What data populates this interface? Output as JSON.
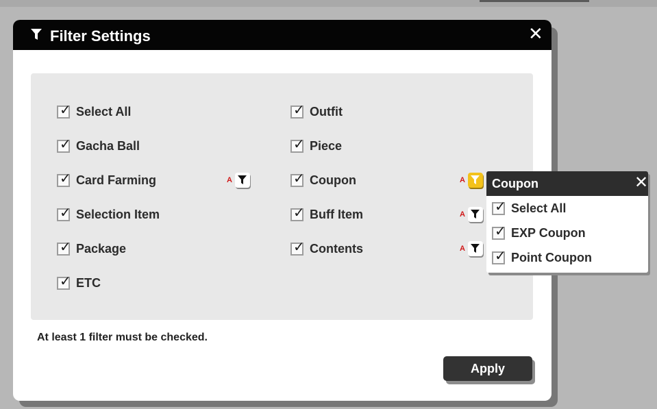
{
  "dialog": {
    "title": "Filter Settings",
    "close_symbol": "✕",
    "title_icon": "filter-icon"
  },
  "filters": {
    "left": [
      {
        "label": "Select All",
        "checked": true
      },
      {
        "label": "Gacha Ball",
        "checked": true
      },
      {
        "label": "Card Farming",
        "checked": true
      },
      {
        "label": "Selection Item",
        "checked": true
      },
      {
        "label": "Package",
        "checked": true
      },
      {
        "label": "ETC",
        "checked": true
      }
    ],
    "right": [
      {
        "label": "Outfit",
        "checked": true
      },
      {
        "label": "Piece",
        "checked": true
      },
      {
        "label": "Coupon",
        "checked": true
      },
      {
        "label": "Buff Item",
        "checked": true
      },
      {
        "label": "Contents",
        "checked": true
      }
    ],
    "sub_filter_marker": "A",
    "check_symbol": "✓"
  },
  "note": "At least 1 filter must be checked.",
  "apply_label": "Apply",
  "popup": {
    "title": "Coupon",
    "close_symbol": "✕",
    "items": [
      {
        "label": "Select All",
        "checked": true
      },
      {
        "label": "EXP Coupon",
        "checked": true
      },
      {
        "label": "Point Coupon",
        "checked": true
      }
    ]
  },
  "colors": {
    "header": "#050505",
    "panel": "#e8e8e8",
    "active_filter": "#f3c21b",
    "marker": "#d11a1a"
  }
}
